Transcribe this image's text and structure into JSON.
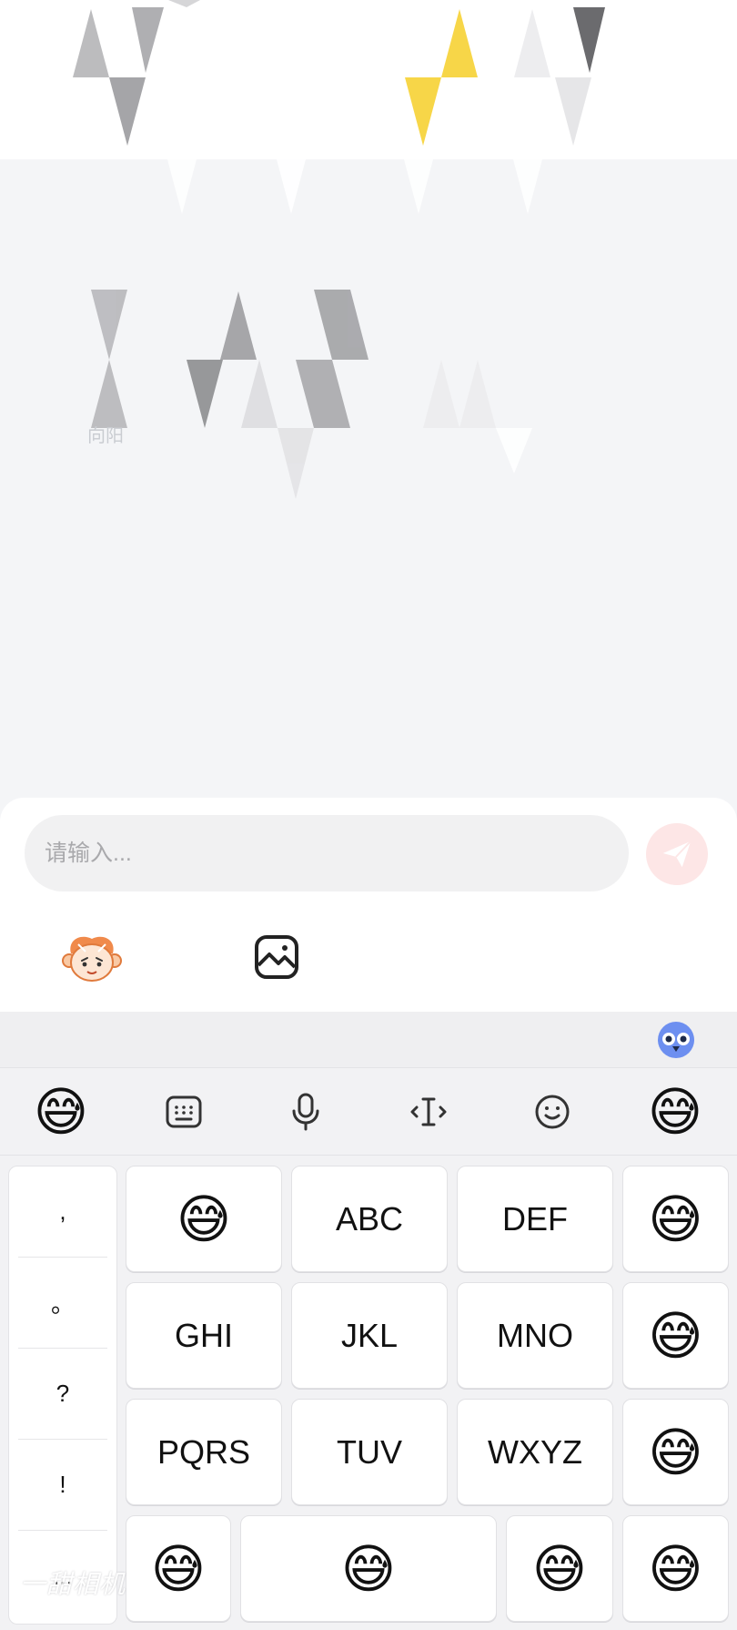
{
  "chat": {
    "faint_fragment": "向阳"
  },
  "input": {
    "placeholder": "请输入..."
  },
  "toolbar_icons": {
    "send": "send-icon",
    "mascot": "mascot-icon",
    "image": "image-icon"
  },
  "keyboard": {
    "assistant_icon": "assistant-bird-icon",
    "toolbar": {
      "left_emoji": "😅",
      "keyboard_icon": "keyboard-icon",
      "mic_icon": "microphone-icon",
      "cursor_icon": "cursor-icon",
      "smile_icon": "smile-icon",
      "right_emoji": "😅"
    },
    "punctuation": [
      ",",
      "。",
      "?",
      "!",
      "..."
    ],
    "rows": [
      [
        "😅",
        "ABC",
        "DEF",
        "😅"
      ],
      [
        "GHI",
        "JKL",
        "MNO",
        "😅"
      ],
      [
        "PQRS",
        "TUV",
        "WXYZ",
        "😅"
      ]
    ],
    "bottom_row": [
      "😅",
      "😅",
      "😅",
      "😅"
    ]
  },
  "watermark": "一甜相机",
  "colors": {
    "send_button_bg": "#fde6e6",
    "send_icon": "#ffffff",
    "accent_yellow": "#fcd535"
  }
}
